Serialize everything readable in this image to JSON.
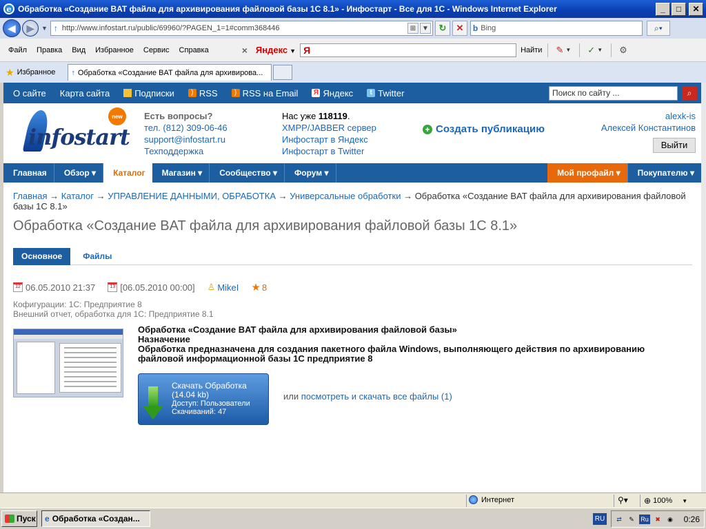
{
  "window": {
    "title": "Обработка «Создание BAT файла для архивирования файловой базы 1С 8.1» - Инфостарт - Все для 1С - Windows Internet Explorer"
  },
  "addressbar": {
    "url": "http://www.infostart.ru/public/69960/?PAGEN_1=1#comm368446",
    "search_placeholder": "Bing"
  },
  "menubar": {
    "items": [
      "Файл",
      "Правка",
      "Вид",
      "Избранное",
      "Сервис",
      "Справка"
    ],
    "yandex_label": "Яндекс",
    "yandex_input": "Я",
    "find_label": "Найти"
  },
  "favbar": {
    "favorites_label": "Избранное",
    "tab_title": "Обработка «Создание BAT файла для архивирова..."
  },
  "site_topbar": {
    "links": [
      "О сайте",
      "Карта сайта",
      "Подписки",
      "RSS",
      "RSS на Email",
      "Яндекс",
      "Twitter"
    ],
    "search_placeholder": "Поиск по сайту ..."
  },
  "header": {
    "logo_badge": "new",
    "logo_text": "infostart",
    "question": "Есть вопросы?",
    "phone": "тел. (812) 309-06-46",
    "email": "support@infostart.ru",
    "support": "Техподдержка",
    "count_prefix": "Нас уже ",
    "count": "118119",
    "count_suffix": ".",
    "stats_links": [
      "XMPP/JABBER сервер",
      "Инфостарт в Яндекс",
      "Инфостарт в Twitter"
    ],
    "create_label": "Создать публикацию",
    "username": "alexk-is",
    "fullname": "Алексей Константинов",
    "logout_label": "Выйти"
  },
  "mainnav": {
    "items": [
      "Главная",
      "Обзор ▾",
      "Каталог",
      "Магазин ▾",
      "Сообщество ▾",
      "Форум ▾"
    ],
    "right": [
      "Мой профайл ▾",
      "Покупателю ▾"
    ]
  },
  "breadcrumbs": {
    "links": [
      "Главная",
      "Каталог",
      "УПРАВЛЕНИЕ ДАННЫМИ, ОБРАБОТКА",
      "Универсальные обработки"
    ],
    "sep": " → ",
    "current": "Обработка «Создание BAT файла для архивирования файловой базы 1С 8.1»"
  },
  "page": {
    "title": "Обработка «Создание BAT файла для архивирования файловой базы 1С 8.1»",
    "tabs": [
      "Основное",
      "Файлы"
    ],
    "date_created": "06.05.2010 21:37",
    "date_updated": "[06.05.2010 00:00]",
    "author": "MikeI",
    "rating": "8",
    "config": "Кофигурации: 1С: Предприятие 8",
    "type": "Внешний отчет, обработка для 1С: Предприятие 8.1",
    "desc_title": "Обработка «Создание BAT файла для архивирования файловой базы»",
    "desc_heading": "Назначение",
    "desc_text": "Обработка предназначена для создания пакетного файла Windows, выполняющего действия по архивированию файловой информационной базы 1С предприятие 8",
    "download": {
      "label": "Скачать Обработка",
      "size": "(14.04 kb)",
      "access": "Доступ: Пользователи",
      "downloads": "Скачиваний: 47"
    },
    "or_text": "или ",
    "all_files_link": "посмотреть и скачать все файлы (1)"
  },
  "statusbar": {
    "zone": "Интернет",
    "zoom": "100%"
  },
  "taskbar": {
    "start": "Пуск",
    "task_title": "Обработка «Создан...",
    "lang": "RU",
    "tray_lang": "Ru",
    "clock": "0:26"
  }
}
